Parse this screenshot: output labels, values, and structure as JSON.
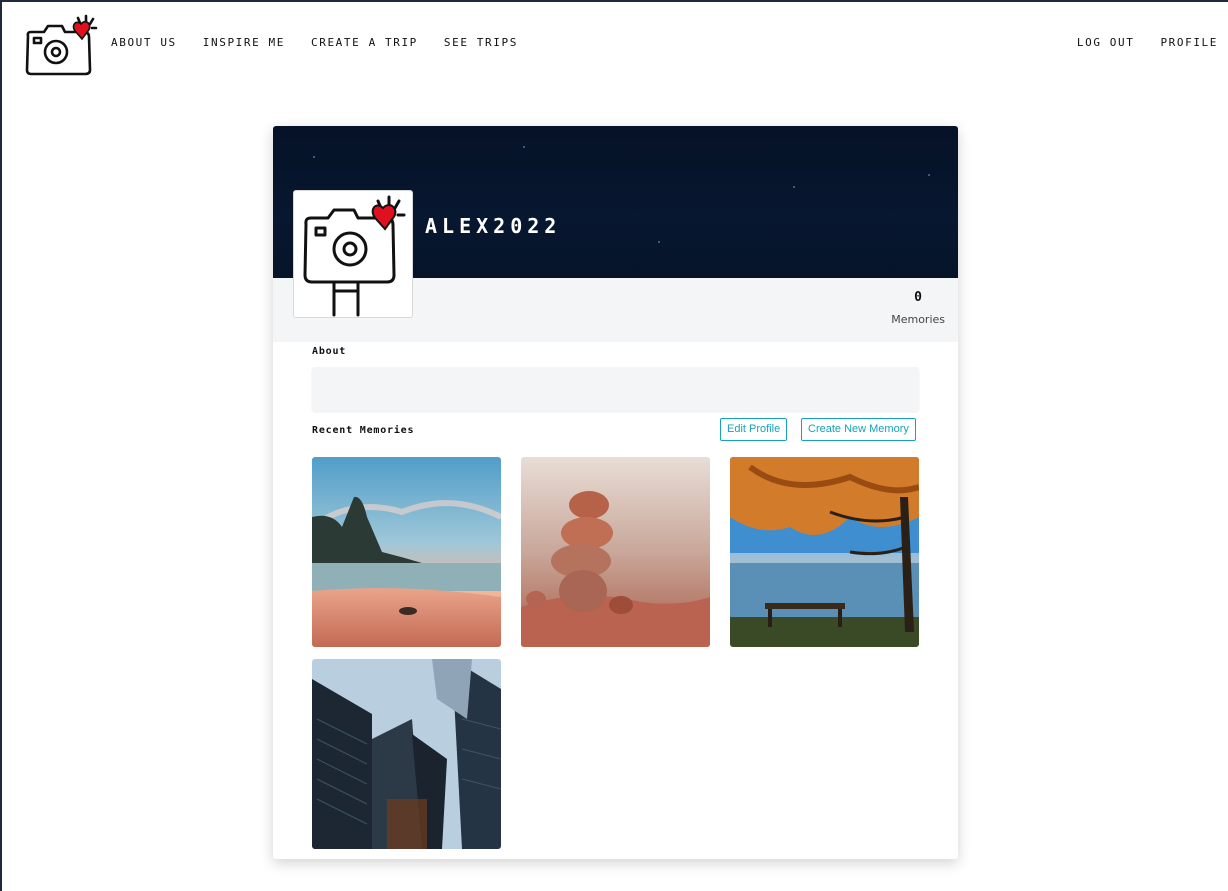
{
  "nav": {
    "left": [
      "About Us",
      "Inspire Me",
      "Create a Trip",
      "See Trips"
    ],
    "right": [
      "Log Out",
      "Profile"
    ]
  },
  "profile": {
    "username": "ALEX2022",
    "memories_count": "0",
    "memories_label": "Memories"
  },
  "sections": {
    "about_title": "About",
    "about_text": "",
    "recent_title": "Recent Memories"
  },
  "buttons": {
    "edit_profile": "Edit Profile",
    "create_memory": "Create New Memory"
  },
  "memories": [
    {
      "subject": "beach-sunset-photo"
    },
    {
      "subject": "stacked-stones-photo"
    },
    {
      "subject": "autumn-tree-lake-photo"
    },
    {
      "subject": "skyscrapers-photo"
    }
  ],
  "colors": {
    "banner": "#061226",
    "accent": "#17a2b8",
    "heart": "#e0101e"
  }
}
